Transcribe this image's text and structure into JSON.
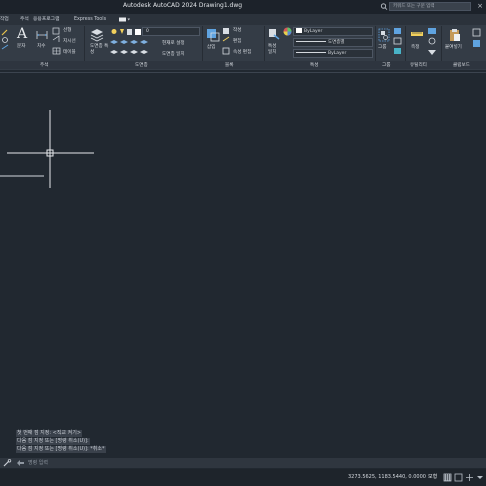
{
  "titlebar": {
    "title": "Autodesk AutoCAD 2024    Drawing1.dwg",
    "search_placeholder": "키워드 또는 구문 입력",
    "close": "×"
  },
  "tabs": [
    "작업",
    "주석",
    "응용프로그램",
    "Express Tools"
  ],
  "ribbon": {
    "annotation": {
      "text": "문자",
      "dimension": "치수",
      "leader": "지시선",
      "table": "테이블",
      "linear": "선형",
      "panel": "주석"
    },
    "layers": {
      "properties": "도면층 특성",
      "current_layer": "0",
      "set_current": "현재로 설정",
      "match": "도면층 일치",
      "panel": "도면층"
    },
    "block": {
      "insert": "삽입",
      "create": "작성",
      "edit": "편집",
      "attributes": "속성 편집",
      "panel": "블록"
    },
    "properties": {
      "match": "특성 일치",
      "color": "ByLayer",
      "linetype": "도면층별",
      "lineweight": "ByLayer",
      "panel": "특성"
    },
    "groups": {
      "group": "그룹",
      "panel": "그룹"
    },
    "utilities": {
      "measure": "측정",
      "panel": "유틸리티"
    },
    "clipboard": {
      "paste": "붙여넣기",
      "panel": "클립보드"
    }
  },
  "command": {
    "history": [
      "첫 번째 점 지정:  <직교 켜기>",
      "다음 점 지정 또는 [명령 취소(U)]:",
      "다음 점 지정 또는 [명령 취소(U)]: *취소*"
    ],
    "placeholder": "명령 입력"
  },
  "status": {
    "coords": "3273.5625, 1183.5440, 0.0000",
    "model": "모형"
  }
}
